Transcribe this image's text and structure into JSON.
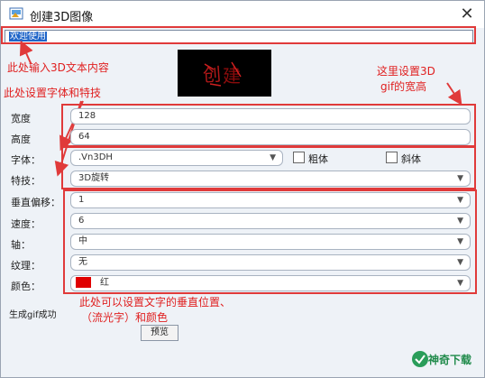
{
  "window": {
    "title": "创建3D图像",
    "close_glyph": "✕"
  },
  "text_input": {
    "value": "欢迎使用"
  },
  "annotations": {
    "text_note": "此处输入3D文本内容",
    "font_note": "此处设置字体和特技",
    "size_note_line1": "这里设置3D",
    "size_note_line2": "gif的宽高",
    "color_note_line1": "此处可以设置文字的垂直位置、",
    "color_note_line2": "（流光字）和颜色"
  },
  "fields": {
    "width_label": "宽度",
    "width_value": "128",
    "height_label": "高度",
    "height_value": "64",
    "font_label": "字体：",
    "font_value": ".Vn3DH",
    "bold_label": "粗体",
    "italic_label": "斜体",
    "effect_label": "特技：",
    "effect_value": "3D旋转",
    "voffset_label": "垂直偏移：",
    "voffset_value": "1",
    "speed_label": "速度：",
    "speed_value": "6",
    "axis_label": "轴：",
    "axis_value": "中",
    "texture_label": "纹理：",
    "texture_value": "无",
    "color_label": "颜色：",
    "color_value": "红"
  },
  "status": {
    "text": "生成gif成功"
  },
  "buttons": {
    "preview_label": "预览"
  },
  "logo": {
    "text": "神奇下载"
  },
  "colors": {
    "annotation_red": "#e03a3a",
    "swatch_red": "#e00000",
    "selection_blue": "#1e64c8"
  },
  "icons": [
    "app-icon",
    "close-icon",
    "chevron-down-icon",
    "arrow-icon",
    "logo-icon"
  ]
}
